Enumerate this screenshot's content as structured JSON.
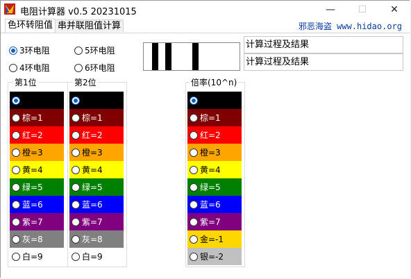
{
  "window": {
    "title": "电阻计算器 v0.5 20231015",
    "minimize": "—",
    "maximize": "☐",
    "close": "✕"
  },
  "tabs": [
    {
      "label": "色环转阻值"
    },
    {
      "label": "串并联阻值计算"
    }
  ],
  "brand": "邪恶海盗 www.hidao.org",
  "band_modes": [
    {
      "label": "3环电阻",
      "checked": true
    },
    {
      "label": "5环电阻",
      "checked": false
    },
    {
      "label": "4环电阻",
      "checked": false
    },
    {
      "label": "6环电阻",
      "checked": false
    }
  ],
  "results": [
    "计算过程及结果",
    "计算过程及结果"
  ],
  "digit1": {
    "label": "第1位",
    "rows": [
      {
        "text": "",
        "color": "#000000",
        "textColor": "#ffffff",
        "checked": true
      },
      {
        "text": "棕=1",
        "color": "#800000",
        "textColor": "#ffffff"
      },
      {
        "text": "红=2",
        "color": "#ff0000",
        "textColor": "#ffffff"
      },
      {
        "text": "橙=3",
        "color": "#ffa500",
        "textColor": "#000000"
      },
      {
        "text": "黄=4",
        "color": "#ffff00",
        "textColor": "#000000"
      },
      {
        "text": "绿=5",
        "color": "#008000",
        "textColor": "#ffffff"
      },
      {
        "text": "蓝=6",
        "color": "#0000ff",
        "textColor": "#ffffff"
      },
      {
        "text": "紫=7",
        "color": "#800080",
        "textColor": "#ffffff"
      },
      {
        "text": "灰=8",
        "color": "#808080",
        "textColor": "#ffffff"
      },
      {
        "text": "白=9",
        "color": "#ffffff",
        "textColor": "#000000"
      }
    ]
  },
  "digit2": {
    "label": "第2位",
    "rows": [
      {
        "text": "",
        "color": "#000000",
        "textColor": "#ffffff",
        "checked": true
      },
      {
        "text": "棕=1",
        "color": "#800000",
        "textColor": "#ffffff"
      },
      {
        "text": "红=2",
        "color": "#ff0000",
        "textColor": "#ffffff"
      },
      {
        "text": "橙=3",
        "color": "#ffa500",
        "textColor": "#000000"
      },
      {
        "text": "黄=4",
        "color": "#ffff00",
        "textColor": "#000000"
      },
      {
        "text": "绿=5",
        "color": "#008000",
        "textColor": "#ffffff"
      },
      {
        "text": "蓝=6",
        "color": "#0000ff",
        "textColor": "#ffffff"
      },
      {
        "text": "紫=7",
        "color": "#800080",
        "textColor": "#ffffff"
      },
      {
        "text": "灰=8",
        "color": "#808080",
        "textColor": "#ffffff"
      },
      {
        "text": "白=9",
        "color": "#ffffff",
        "textColor": "#000000"
      }
    ]
  },
  "multiplier": {
    "label": "倍率(10^n)",
    "rows": [
      {
        "text": "",
        "color": "#000000",
        "textColor": "#ffffff",
        "checked": true
      },
      {
        "text": "棕=1",
        "color": "#800000",
        "textColor": "#ffffff"
      },
      {
        "text": "红=2",
        "color": "#ff0000",
        "textColor": "#ffffff"
      },
      {
        "text": "橙=3",
        "color": "#ffa500",
        "textColor": "#000000"
      },
      {
        "text": "黄=4",
        "color": "#ffff00",
        "textColor": "#000000"
      },
      {
        "text": "绿=5",
        "color": "#008000",
        "textColor": "#ffffff"
      },
      {
        "text": "蓝=6",
        "color": "#0000ff",
        "textColor": "#ffffff"
      },
      {
        "text": "紫=7",
        "color": "#800080",
        "textColor": "#ffffff"
      },
      {
        "text": "金=-1",
        "color": "#ffd700",
        "textColor": "#000000"
      },
      {
        "text": "银=-2",
        "color": "#c0c0c0",
        "textColor": "#000000"
      }
    ]
  }
}
